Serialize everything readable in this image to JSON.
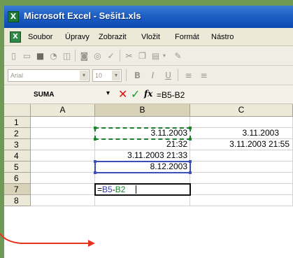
{
  "window": {
    "title": "Microsoft Excel - Sešit1.xls",
    "app_icon_glyph": "X"
  },
  "menu": {
    "items": [
      "Soubor",
      "Úpravy",
      "Zobrazit",
      "Vložit",
      "Formát",
      "Nástro"
    ]
  },
  "font_toolbar": {
    "font_name": "Arial",
    "font_size": "10"
  },
  "formula_bar": {
    "name_box": "SUMA",
    "dropdown_glyph": "▾",
    "cancel_glyph": "✕",
    "enter_glyph": "✓",
    "fx_label": "fx",
    "content": "=B5-B2"
  },
  "grid": {
    "columns": [
      "A",
      "B",
      "C"
    ],
    "rows": [
      "1",
      "2",
      "3",
      "4",
      "5",
      "6",
      "7",
      "8"
    ],
    "cells": {
      "B2": "3.11.2003",
      "C2": "3.11.2003",
      "B3": "21:32",
      "C3": "3.11.2003 21:55",
      "B4": "3.11.2003 21:33",
      "B5": "8.12.2003"
    },
    "editing_cell": {
      "ref": "B7",
      "formula_parts": [
        "=",
        "B5",
        "-",
        "B2"
      ]
    }
  },
  "colors": {
    "ref_blue": "#2a3dbd",
    "ref_green": "#168a2a",
    "pointer_arrow": "#e8331c",
    "titlebar": "#1f5fc4"
  },
  "icons": {
    "toolbar1": [
      "new-icon",
      "open-icon",
      "save-icon",
      "permission-icon",
      "email-icon",
      "print-icon",
      "print-preview-icon",
      "spelling-icon",
      "cut-icon",
      "copy-icon",
      "paste-icon",
      "format-painter-icon"
    ],
    "toolbar2": [
      "bold-icon",
      "italic-icon",
      "underline-icon",
      "align-left-icon",
      "align-center-icon"
    ]
  }
}
